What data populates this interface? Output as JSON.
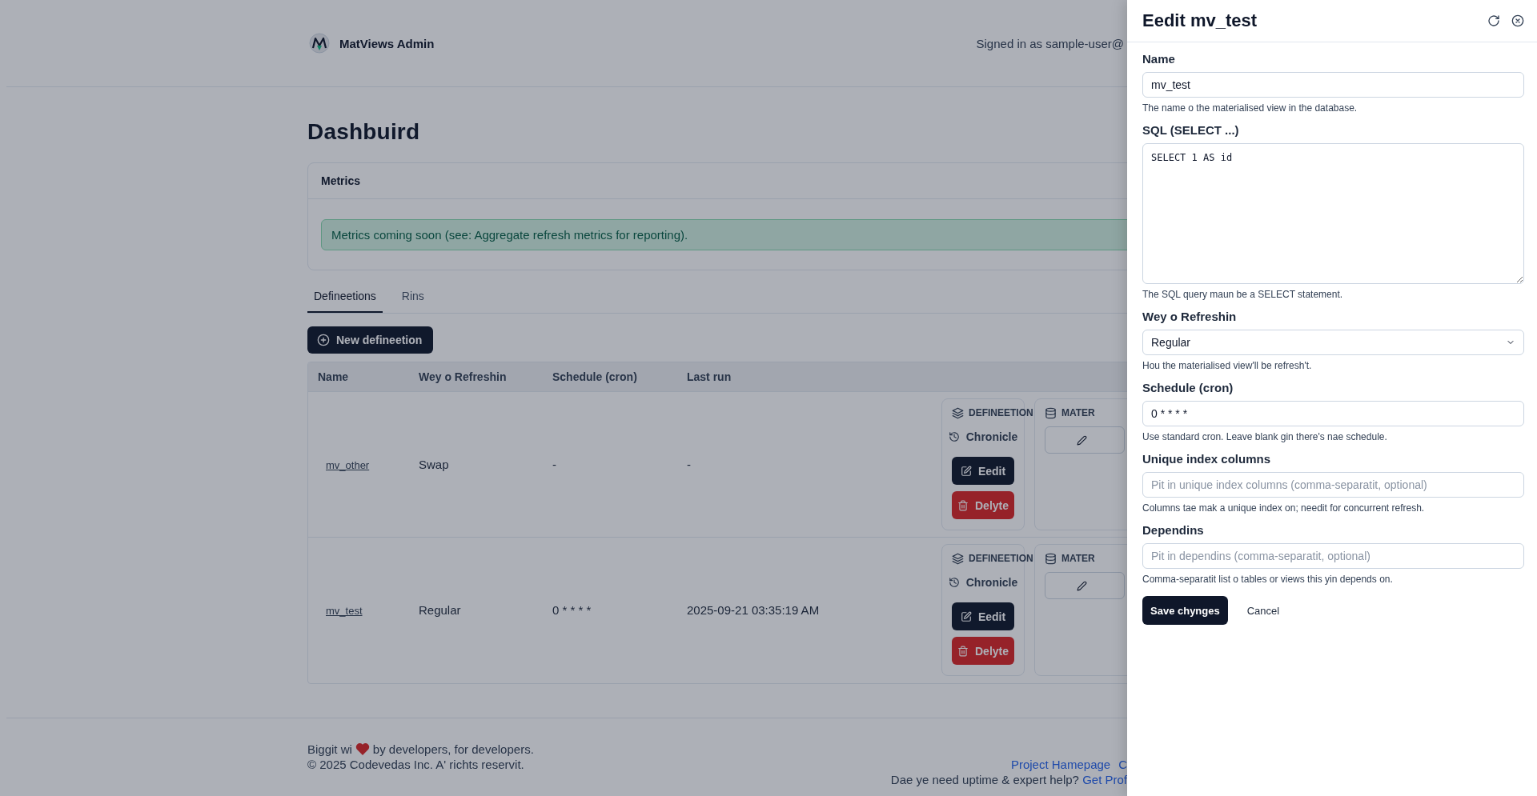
{
  "app": {
    "name": "MatViews Admin",
    "signed_in": "Signed in as sample-user@"
  },
  "page": {
    "title": "Dashbuird"
  },
  "metrics": {
    "title": "Metrics",
    "alert": "Metrics coming soon (see: Aggregate refresh metrics for reporting)."
  },
  "tabs": [
    {
      "label": "Defineetions",
      "selected": true
    },
    {
      "label": "Rins",
      "selected": false
    }
  ],
  "new_button": "New defineetion",
  "table": {
    "columns": [
      "Name",
      "Wey o Refreshin",
      "Schedule (cron)",
      "Last run"
    ],
    "rows": [
      {
        "name": "mv_other",
        "refresh": "Swap",
        "schedule": "-",
        "last_run": "-",
        "definition": {
          "heading": "DEFINEETION",
          "history": "Chronicle",
          "edit": "Eedit",
          "delete": "Delyte"
        },
        "materialise": {
          "heading": "MATER"
        }
      },
      {
        "name": "mv_test",
        "refresh": "Regular",
        "schedule": "0 * * * *",
        "last_run": "2025-09-21 03:35:19 AM",
        "definition": {
          "heading": "DEFINEETION",
          "history": "Chronicle",
          "edit": "Eedit",
          "delete": "Delyte"
        },
        "materialise": {
          "heading": "MATER"
        }
      }
    ]
  },
  "footer": {
    "tagline_before": "Biggit wi",
    "tagline_after": "by developers, for developers.",
    "copyright": "© 2025 Codevedas Inc. A' richts reservit.",
    "links": [
      "Project Hamepage",
      "C"
    ],
    "help": "Dae ye need uptime & expert help?",
    "help_link": "Get Prof"
  },
  "drawer": {
    "title": "Eedit mv_test",
    "fields": [
      {
        "kind": "input",
        "label": "Name",
        "value": "mv_test",
        "help": "The name o the materialised view in the database."
      },
      {
        "kind": "textarea",
        "label": "SQL (SELECT ...)",
        "value": "SELECT 1 AS id",
        "help": "The SQL query maun be a SELECT statement."
      },
      {
        "kind": "select",
        "label": "Wey o Refreshin",
        "value": "Regular",
        "help": "Hou the materialised view'll be refresh't."
      },
      {
        "kind": "input",
        "label": "Schedule (cron)",
        "value": "0 * * * *",
        "help": "Use standard cron. Leave blank gin there's nae schedule."
      },
      {
        "kind": "input",
        "label": "Unique index columns",
        "placeholder": "Pit in unique index columns (comma-separatit, optional)",
        "help": "Columns tae mak a unique index on; needit for concurrent refresh."
      },
      {
        "kind": "input",
        "label": "Dependins",
        "placeholder": "Pit in dependins (comma-separatit, optional)",
        "help": "Comma-separatit list o tables or views this yin depends on."
      }
    ],
    "save": "Save chynges",
    "cancel": "Cancel"
  }
}
